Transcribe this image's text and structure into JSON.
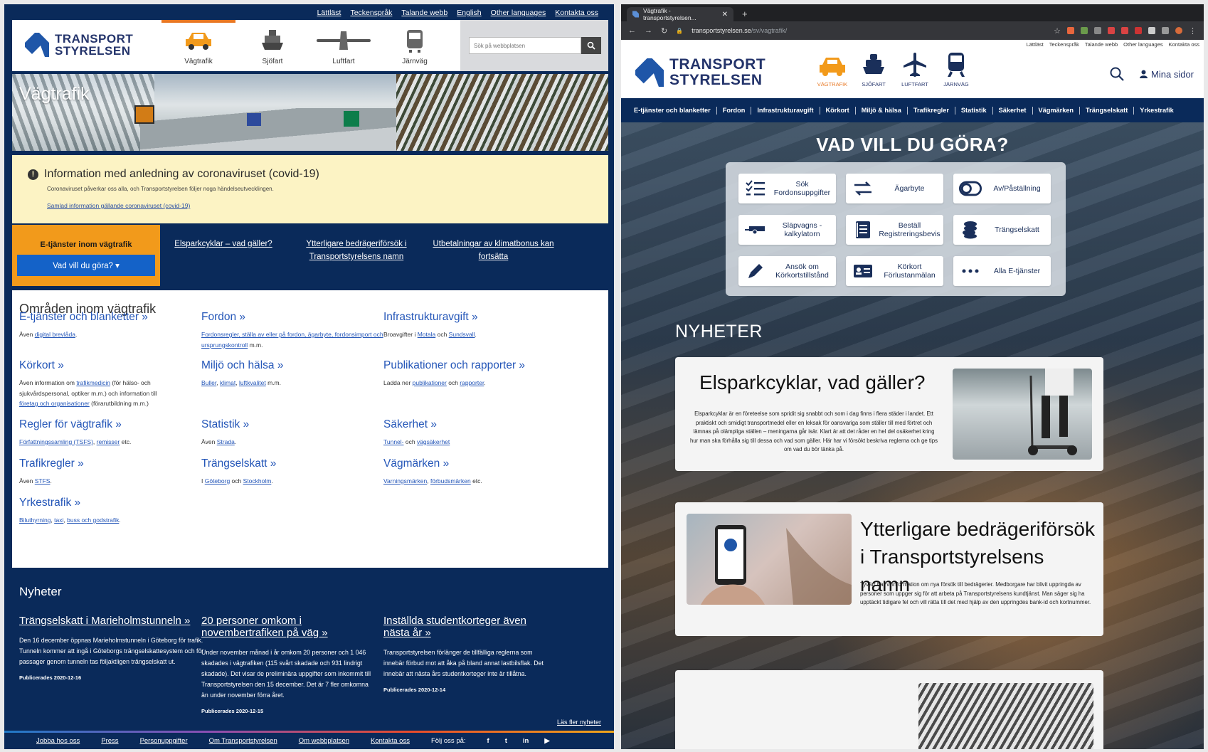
{
  "left": {
    "utility_links": [
      "Lättläst",
      "Teckenspråk",
      "Talande webb",
      "English",
      "Other languages",
      "Kontakta oss"
    ],
    "logo": {
      "line1": "TRANSPORT",
      "line2": "STYRELSEN"
    },
    "nav": [
      "Vägtrafik",
      "Sjöfart",
      "Luftfart",
      "Järnväg"
    ],
    "search": {
      "placeholder": "Sök på webbplatsen"
    },
    "hero_title": "Vägtrafik",
    "alert": {
      "title": "Information med anledning av coronaviruset (covid-19)",
      "desc": "Coronaviruset påverkar oss alla, och Transportstyrelsen följer noga händelseutvecklingen.",
      "link": "Samlad information gällande coronaviruset (covid-19)"
    },
    "eservices": {
      "title": "E-tjänster inom vägtrafik",
      "button": "Vad vill du göra? ▾"
    },
    "featured": [
      "Elsparkcyklar – vad gäller?",
      "Ytterligare bedrägeriförsök i Transportstyrelsens namn",
      "Utbetalningar av klimatbonus kan fortsätta"
    ],
    "areas_title": "Områden inom vägtrafik",
    "areas": [
      {
        "title": "E-tjänster och blanketter »",
        "p": "Även ",
        "l1": "digital brevlåda",
        "s": "."
      },
      {
        "title": "Fordon »",
        "p": "",
        "l1": "Fordonsregler, ställa av eller på fordon, ägarbyte, fordonsimport och ursprungskontroll",
        "s": " m.m."
      },
      {
        "title": "Infrastrukturavgift »",
        "p": "Broavgifter i ",
        "l1": "Motala",
        "m": " och ",
        "l2": "Sundsvall",
        "s": "."
      },
      {
        "title": "Körkort »",
        "p": "Även information om ",
        "l1": "trafikmedicin",
        "m": " (för hälso- och sjukvårdspersonal, optiker m.m.) och information till ",
        "l2": "företag och organisationer",
        "s": " (förarutbildning m.m.)"
      },
      {
        "title": "Miljö och hälsa  »",
        "p": "",
        "l1": "Buller",
        "m": ", ",
        "l2": "klimat",
        "m2": ", ",
        "l3": "luftkvalitet",
        "s": " m.m."
      },
      {
        "title": "Publikationer och rapporter »",
        "p": "Ladda ner ",
        "l1": "publikationer",
        "m": " och ",
        "l2": "rapporter",
        "s": "."
      },
      {
        "title": "Regler för vägtrafik »",
        "p": "",
        "l1": "Författningssamling (TSFS)",
        "m": ", ",
        "l2": "remisser",
        "s": " etc."
      },
      {
        "title": "Statistik »",
        "p": "Även ",
        "l1": "Strada",
        "s": "."
      },
      {
        "title": "Säkerhet »",
        "p": "",
        "l1": "Tunnel-",
        "m": " och ",
        "l2": "vägsäkerhet",
        "s": ""
      },
      {
        "title": "Trafikregler »",
        "p": "Även ",
        "l1": "STFS",
        "s": "."
      },
      {
        "title": "Trängselskatt  »",
        "p": "I ",
        "l1": "Göteborg",
        "m": " och ",
        "l2": "Stockholm",
        "s": "."
      },
      {
        "title": "Vägmärken »",
        "p": "",
        "l1": "Varningsmärken",
        "m": ", ",
        "l2": "förbudsmärken",
        "s": " etc."
      },
      {
        "title": "Yrkestrafik »",
        "p": "",
        "l1": "Biluthyrning",
        "m": ", ",
        "l2": "taxi",
        "m2": ", ",
        "l3": "buss och godstrafik",
        "s": "."
      }
    ],
    "news_title": "Nyheter",
    "news": [
      {
        "title": "Trängselskatt i Marieholmstunneln »",
        "body": "Den 16 december öppnas Marieholmstunneln i Göteborg för trafik. Tunneln kommer att ingå i Göteborgs trängselskattesystem och för passager genom tunneln tas följaktligen trängselskatt ut.",
        "date": "Publicerades 2020-12-16"
      },
      {
        "title": "20 personer omkom i novembertrafiken på väg »",
        "body": "Under november månad i år omkom 20 personer och 1 046 skadades i vägtrafiken (115 svårt skadade och 931 lindrigt skadade). Det visar de preliminära uppgifter som inkommit till Transportstyrelsen den 15 december. Det är 7 fler omkomna än under november förra året.",
        "date": "Publicerades 2020-12-15"
      },
      {
        "title": "Inställda studentkorteger även nästa år »",
        "body": "Transportstyrelsen förlänger de tillfälliga reglerna som innebär förbud mot att åka på bland annat lastbilsflak. Det innebär att nästa års studentkorteger inte är tillåtna.",
        "date": "Publicerades 2020-12-14"
      }
    ],
    "news_more": "Läs fler nyheter",
    "footer": [
      "Jobba hos oss",
      "Press",
      "Personuppgifter",
      "Om Transportstyrelsen",
      "Om webbplatsen",
      "Kontakta oss"
    ],
    "follow": "Följ oss på:"
  },
  "right": {
    "tab_title": "Vägtrafik - transportstyrelsen...",
    "url_host": "transportstyrelsen.se",
    "url_path": "/sv/vagtrafik/",
    "utility_links": [
      "Lättläst",
      "Teckenspråk",
      "Talande webb",
      "Other languages",
      "Kontakta oss"
    ],
    "logo": {
      "line1": "TRANSPORT",
      "line2": "STYRELSEN"
    },
    "nav": [
      "VÄGTRAFIK",
      "SJÖFART",
      "LUFTFART",
      "JÄRNVÄG"
    ],
    "my_pages": "Mina sidor",
    "subnav": [
      "E-tjänster och blanketter",
      "Fordon",
      "Infrastrukturavgift",
      "Körkort",
      "Miljö & hälsa",
      "Trafikregler",
      "Statistik",
      "Säkerhet",
      "Vägmärken",
      "Trängselskatt",
      "Yrkestrafik"
    ],
    "heading": "VAD VILL DU GÖRA?",
    "services": [
      {
        "label": "Sök Fordonsuppgifter",
        "icon": "list-icon"
      },
      {
        "label": "Ägarbyte",
        "icon": "swap-icon"
      },
      {
        "label": "Av/Påställning",
        "icon": "toggle-icon"
      },
      {
        "label": "Släpvagns -kalkylatorn",
        "icon": "trailer-icon"
      },
      {
        "label": "Beställ Registreringsbevis",
        "icon": "document-icon"
      },
      {
        "label": "Trängselskatt",
        "icon": "coins-icon"
      },
      {
        "label": "Ansök om Körkortstillstånd",
        "icon": "pen-icon"
      },
      {
        "label": "Körkort Förlustanmälan",
        "icon": "id-card-icon"
      },
      {
        "label": "Alla E-tjänster",
        "icon": "more-icon"
      }
    ],
    "news_title": "NYHETER",
    "articles": [
      {
        "title": "Elsparkcyklar, vad gäller?",
        "body": "Elsparkcyklar är en företeelse som spridit sig snabbt och som i dag finns i flera städer i landet. Ett praktiskt och smidigt transportmedel eller en leksak för oansvariga som ställer till med förtret och lämnas på olämpliga ställen – meningarna går isär. Klart är att det råder en hel del osäkerhet kring hur man ska förhålla sig till dessa och vad som gäller. Här har vi försökt beskriva reglerna och ge tips om vad du bör tänka på."
      },
      {
        "title": "Ytterligare bedrägeriförsök i Transportstyrelsens namn",
        "body": "Tyvärr har vi information om nya försök till bedrägerier. Medborgare har blivit uppringda av personer som uppger sig för att arbeta på Transportstyrelsens kundtjänst. Man säger sig ha upptäckt tidigare fel och vill rätta till det med hjälp av den uppringdes bank-id och kortnummer."
      }
    ]
  }
}
